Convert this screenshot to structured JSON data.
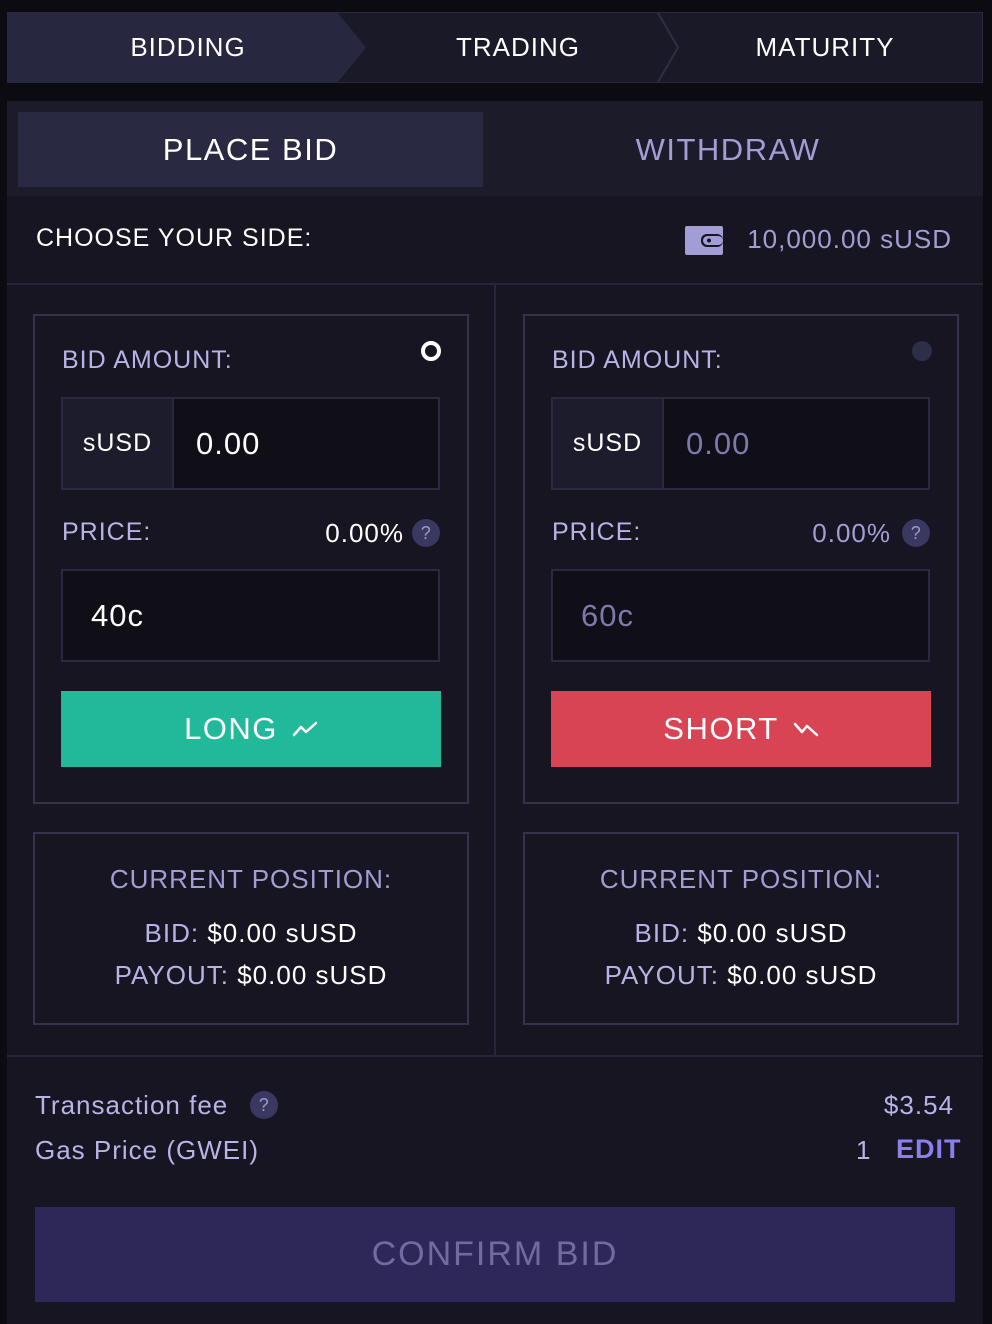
{
  "stepper": {
    "steps": [
      {
        "label": "BIDDING"
      },
      {
        "label": "TRADING"
      },
      {
        "label": "MATURITY"
      }
    ]
  },
  "tabs": {
    "place_bid": "PLACE BID",
    "withdraw": "WITHDRAW"
  },
  "side_header": {
    "title": "CHOOSE YOUR SIDE:",
    "balance": "10,000.00 sUSD",
    "wallet_icon": "wallet-icon"
  },
  "long_panel": {
    "bid_label": "BID AMOUNT:",
    "currency": "sUSD",
    "amount_value": "0.00",
    "price_label": "PRICE:",
    "price_pct": "0.00%",
    "price_value": "40c",
    "button_label": "LONG",
    "selected": true
  },
  "short_panel": {
    "bid_label": "BID AMOUNT:",
    "currency": "sUSD",
    "amount_value": "0.00",
    "price_label": "PRICE:",
    "price_pct": "0.00%",
    "price_value": "60c",
    "button_label": "SHORT",
    "selected": false
  },
  "long_position": {
    "title": "CURRENT POSITION:",
    "bid_key": "BID:",
    "bid_val": "$0.00 sUSD",
    "payout_key": "PAYOUT:",
    "payout_val": "$0.00 sUSD"
  },
  "short_position": {
    "title": "CURRENT POSITION:",
    "bid_key": "BID:",
    "bid_val": "$0.00 sUSD",
    "payout_key": "PAYOUT:",
    "payout_val": "$0.00 sUSD"
  },
  "fees": {
    "tx_fee_label": "Transaction fee",
    "tx_fee_value": "$3.54",
    "gas_label": "Gas Price (GWEI)",
    "gas_value": "1",
    "edit_label": "EDIT",
    "help_glyph": "?"
  },
  "confirm_label": "CONFIRM BID",
  "colors": {
    "long": "#22b99a",
    "short": "#d94454",
    "accent": "#8b7ff0",
    "confirm_bg": "#2e2859"
  }
}
